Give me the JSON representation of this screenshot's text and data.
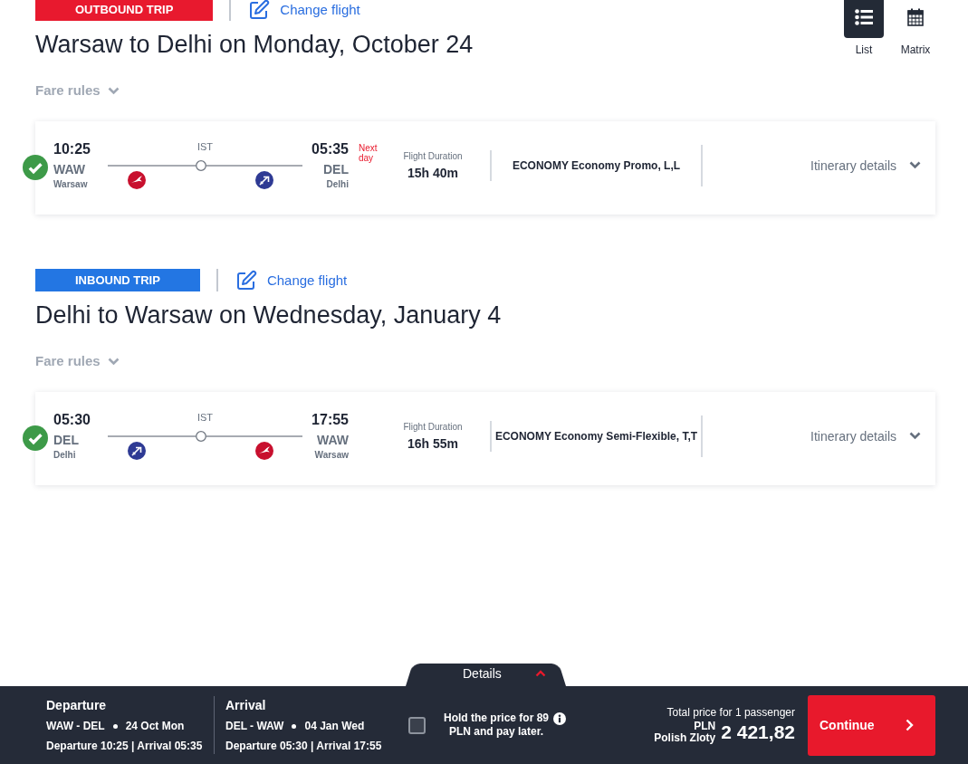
{
  "view_modes": [
    {
      "label": "List",
      "kind": "list",
      "selected": true
    },
    {
      "label": "Matrix",
      "kind": "matrix",
      "selected": false
    }
  ],
  "trips": [
    {
      "kind": "outbound",
      "badge": "OUTBOUND TRIP",
      "change_link": "Change flight",
      "title": "Warsaw to Delhi on Monday, October 24",
      "fare_rules": "Fare rules",
      "flights": [
        {
          "selected": true,
          "departure": {
            "time": "10:25",
            "code": "WAW",
            "city": "Warsaw"
          },
          "stop": "IST",
          "carriers": [
            {
              "kind": "bird",
              "color": "#c8102e"
            },
            {
              "kind": "plane",
              "color": "#2e3a94"
            }
          ],
          "arrival": {
            "time": "05:35",
            "code": "DEL",
            "city": "Delhi",
            "note": "Next day"
          },
          "duration_label": "Flight Duration",
          "duration": "15h 40m",
          "fare_class": "ECONOMY Economy Promo, L,L",
          "details_link": "Itinerary details"
        }
      ]
    },
    {
      "kind": "inbound",
      "badge": "INBOUND TRIP",
      "change_link": "Change flight",
      "title": "Delhi to Warsaw on Wednesday, January 4",
      "fare_rules": "Fare rules",
      "flights": [
        {
          "selected": true,
          "departure": {
            "time": "05:30",
            "code": "DEL",
            "city": "Delhi"
          },
          "stop": "IST",
          "carriers": [
            {
              "kind": "plane",
              "color": "#2e3a94"
            },
            {
              "kind": "bird",
              "color": "#c8102e"
            }
          ],
          "arrival": {
            "time": "17:55",
            "code": "WAW",
            "city": "Warsaw"
          },
          "duration_label": "Flight Duration",
          "duration": "16h 55m",
          "fare_class": "ECONOMY Economy Semi-Flexible, T,T",
          "details_link": "Itinerary details"
        }
      ]
    }
  ],
  "footer": {
    "details_tab": "Details",
    "legs": [
      {
        "heading": "Departure",
        "route": "WAW - DEL",
        "date": "24 Oct Mon",
        "times": "Departure 10:25 | Arrival 05:35"
      },
      {
        "heading": "Arrival",
        "route": "DEL - WAW",
        "date": "04 Jan Wed",
        "times": "Departure 05:30 | Arrival 17:55"
      }
    ],
    "hold_price": {
      "checked": false,
      "text": "**Hold the price** for 89 PLN and pay later."
    },
    "total_label": "Total price for 1 passenger",
    "currency_code": "PLN",
    "currency_name": "Polish Zloty",
    "total": "2 421,82",
    "continue_button": "Continue"
  }
}
